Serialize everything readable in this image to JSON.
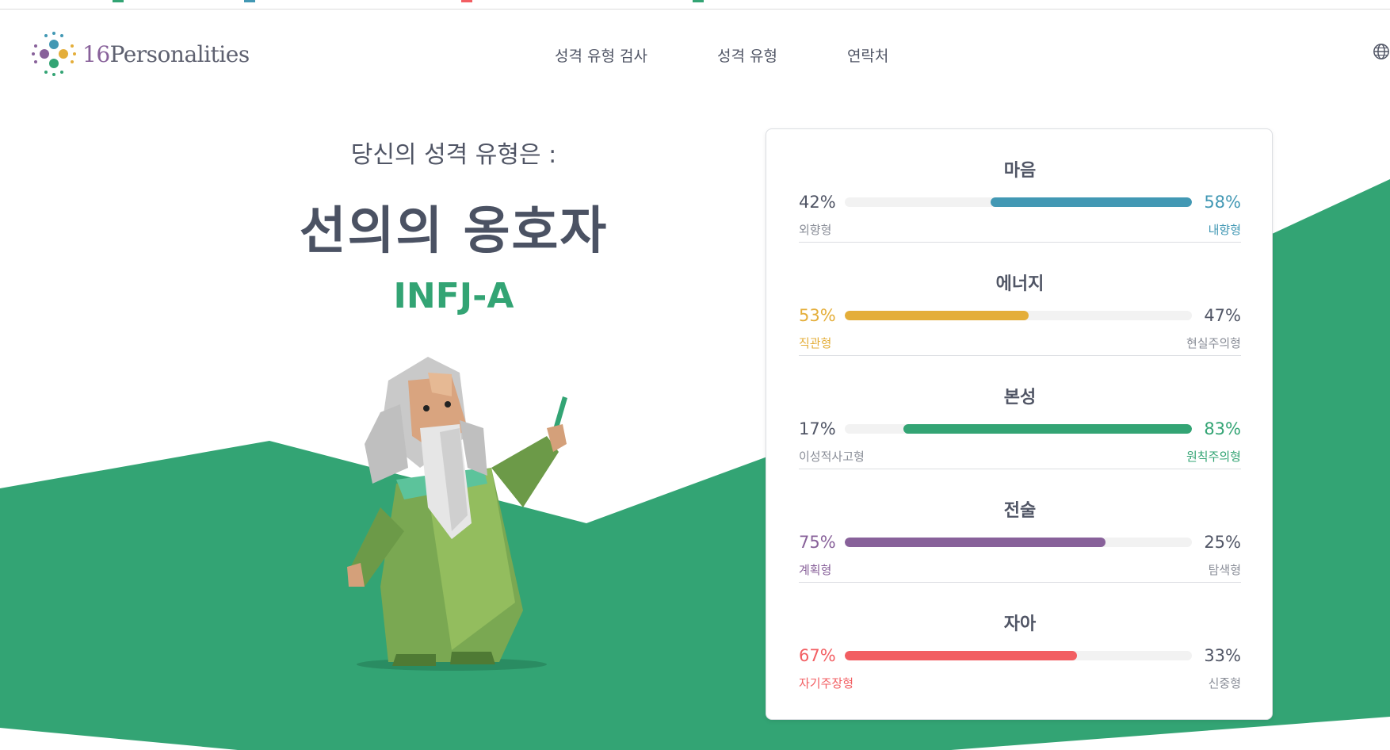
{
  "header": {
    "logo_num": "16",
    "logo_word": "Personalities",
    "nav": [
      "성격 유형 검사",
      "성격 유형",
      "연락처"
    ]
  },
  "hero": {
    "intro": "당신의 성격 유형은 :",
    "type_name": "선의의 옹호자",
    "type_code": "INFJ-A"
  },
  "traits": [
    {
      "title": "마음",
      "left_pct": "42%",
      "right_pct": "58%",
      "left_label": "외향형",
      "right_label": "내향형",
      "dominant": "right",
      "fraction": 0.58,
      "color": "#4298b4"
    },
    {
      "title": "에너지",
      "left_pct": "53%",
      "right_pct": "47%",
      "left_label": "직관형",
      "right_label": "현실주의형",
      "dominant": "left",
      "fraction": 0.53,
      "color": "#e4ae3a"
    },
    {
      "title": "본성",
      "left_pct": "17%",
      "right_pct": "83%",
      "left_label": "이성적사고형",
      "right_label": "원칙주의형",
      "dominant": "right",
      "fraction": 0.83,
      "color": "#33a474"
    },
    {
      "title": "전술",
      "left_pct": "75%",
      "right_pct": "25%",
      "left_label": "계획형",
      "right_label": "탐색형",
      "dominant": "left",
      "fraction": 0.75,
      "color": "#88619a"
    },
    {
      "title": "자아",
      "left_pct": "67%",
      "right_pct": "33%",
      "left_label": "자기주장형",
      "right_label": "신중형",
      "dominant": "left",
      "fraction": 0.67,
      "color": "#f25e62"
    }
  ],
  "colors": {
    "brand_green": "#33a474",
    "text": "#4b5263"
  },
  "icons": {
    "globe": "globe-icon",
    "logo": "logo-dots-icon"
  }
}
